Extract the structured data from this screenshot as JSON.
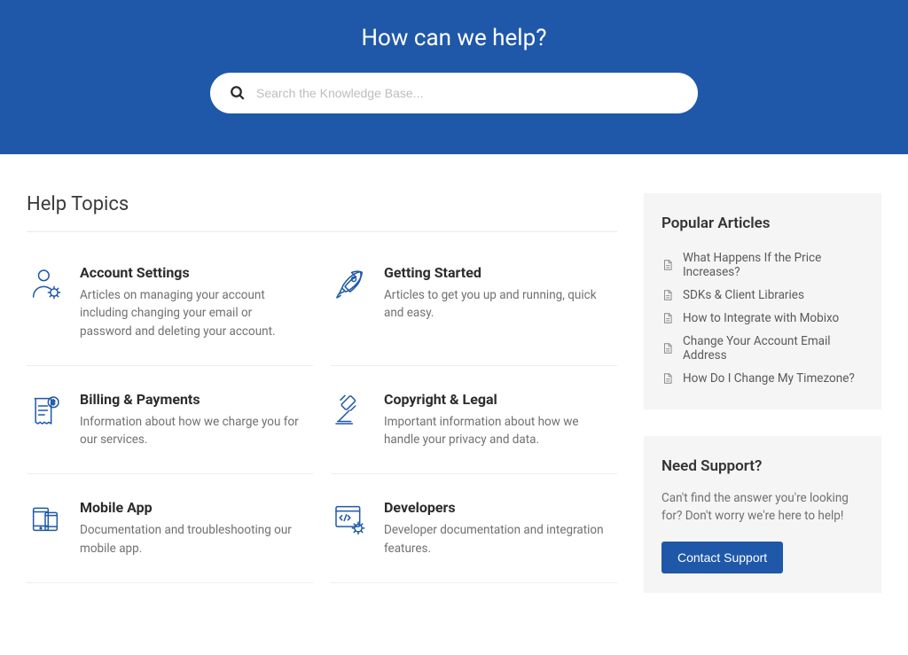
{
  "hero": {
    "title": "How can we help?",
    "search_placeholder": "Search the Knowledge Base..."
  },
  "main": {
    "section_title": "Help Topics",
    "topics": [
      {
        "icon": "account",
        "title": "Account Settings",
        "desc": "Articles on managing your account including changing your email or password and deleting your account."
      },
      {
        "icon": "rocket",
        "title": "Getting Started",
        "desc": "Articles to get you up and running, quick and easy."
      },
      {
        "icon": "billing",
        "title": "Billing & Payments",
        "desc": "Information about how we charge you for our services."
      },
      {
        "icon": "legal",
        "title": "Copyright & Legal",
        "desc": "Important information about how we handle your privacy and data."
      },
      {
        "icon": "mobile",
        "title": "Mobile App",
        "desc": "Documentation and troubleshooting our mobile app."
      },
      {
        "icon": "dev",
        "title": "Developers",
        "desc": "Developer documentation and integration features."
      }
    ]
  },
  "sidebar": {
    "popular_title": "Popular Articles",
    "articles": [
      "What Happens If the Price Increases?",
      "SDKs & Client Libraries",
      "How to Integrate with Mobixo",
      "Change Your Account Email Address",
      "How Do I Change My Timezone?"
    ],
    "support_title": "Need Support?",
    "support_text": "Can't find the answer you're looking for? Don't worry we're here to help!",
    "contact_label": "Contact Support"
  },
  "colors": {
    "brand": "#1f58a9"
  }
}
